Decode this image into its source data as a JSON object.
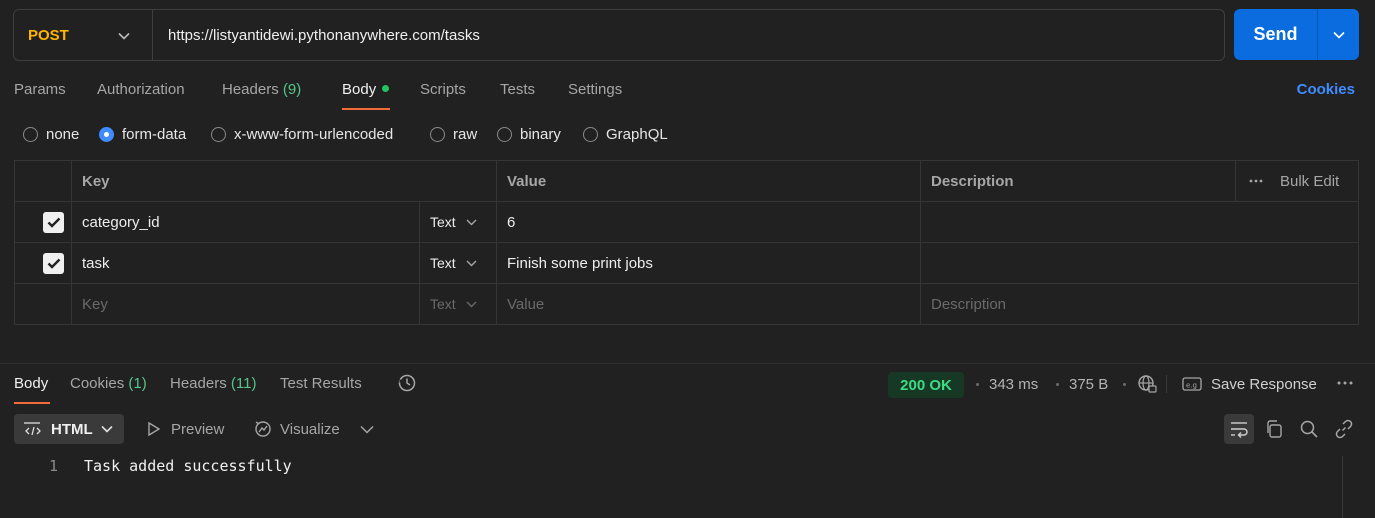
{
  "request": {
    "method": "POST",
    "url": "https://listyantidewi.pythonanywhere.com/tasks",
    "send_label": "Send"
  },
  "req_tabs": {
    "params": "Params",
    "authorization": "Authorization",
    "headers": "Headers",
    "headers_count": "(9)",
    "body": "Body",
    "scripts": "Scripts",
    "tests": "Tests",
    "settings": "Settings",
    "cookies": "Cookies"
  },
  "body_types": {
    "none": "none",
    "form_data": "form-data",
    "urlencoded": "x-www-form-urlencoded",
    "raw": "raw",
    "binary": "binary",
    "graphql": "GraphQL",
    "selected": "form-data"
  },
  "table": {
    "headers": {
      "key": "Key",
      "value": "Value",
      "description": "Description",
      "bulk_edit": "Bulk Edit"
    },
    "rows": [
      {
        "checked": true,
        "key": "category_id",
        "type": "Text",
        "value": "6",
        "description": ""
      },
      {
        "checked": true,
        "key": "task",
        "type": "Text",
        "value": "Finish some print jobs",
        "description": ""
      }
    ],
    "placeholder": {
      "key": "Key",
      "type": "Text",
      "value": "Value",
      "description": "Description"
    }
  },
  "response": {
    "tabs": {
      "body": "Body",
      "cookies": "Cookies",
      "cookies_count": "(1)",
      "headers": "Headers",
      "headers_count": "(11)",
      "test_results": "Test Results"
    },
    "status": "200 OK",
    "time": "343 ms",
    "size": "375 B",
    "save_label": "Save Response",
    "format": "HTML",
    "preview": "Preview",
    "visualize": "Visualize",
    "lines": [
      {
        "num": "1",
        "text": "Task added successfully"
      }
    ]
  },
  "colors": {
    "method": "#ffb400",
    "send": "#0a6cde",
    "accent_tab": "#f26b3a",
    "count_green": "#53c68a",
    "status_ok": "#3ddc84",
    "link": "#3f8cff"
  }
}
